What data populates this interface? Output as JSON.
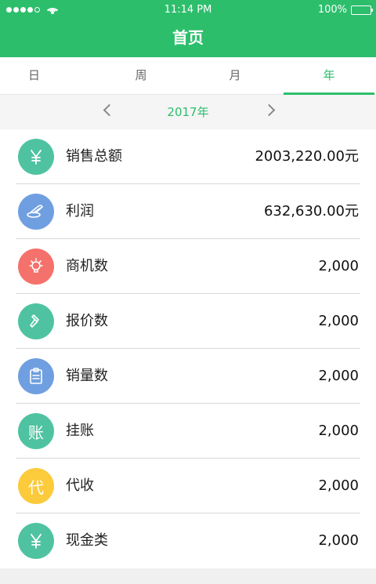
{
  "status_bar": {
    "time": "11:14 PM",
    "battery": "100%"
  },
  "header": {
    "title": "首页"
  },
  "tabs": [
    {
      "label": "日",
      "active": false
    },
    {
      "label": "周",
      "active": false
    },
    {
      "label": "月",
      "active": false
    },
    {
      "label": "年",
      "active": true
    }
  ],
  "year_selector": {
    "label": "2017年"
  },
  "items": [
    {
      "label": "销售总额",
      "value": "2003,220.00元",
      "icon": "yuan-icon",
      "color": "#4fc3a1"
    },
    {
      "label": "利润",
      "value": "632,630.00元",
      "icon": "coins-icon",
      "color": "#6f9fe0"
    },
    {
      "label": "商机数",
      "value": "2,000",
      "icon": "lightbulb-icon",
      "color": "#f4726b"
    },
    {
      "label": "报价数",
      "value": "2,000",
      "icon": "hammer-icon",
      "color": "#4fc3a1"
    },
    {
      "label": "销量数",
      "value": "2,000",
      "icon": "clipboard-icon",
      "color": "#6f9fe0"
    },
    {
      "label": "挂账",
      "value": "2,000",
      "icon": "zhang-icon",
      "icon_text": "账",
      "color": "#4fc3a1"
    },
    {
      "label": "代收",
      "value": "2,000",
      "icon": "dai-icon",
      "icon_text": "代",
      "color": "#fbcb3c"
    },
    {
      "label": "现金类",
      "value": "2,000",
      "icon": "yuan-icon",
      "color": "#4fc3a1"
    }
  ]
}
